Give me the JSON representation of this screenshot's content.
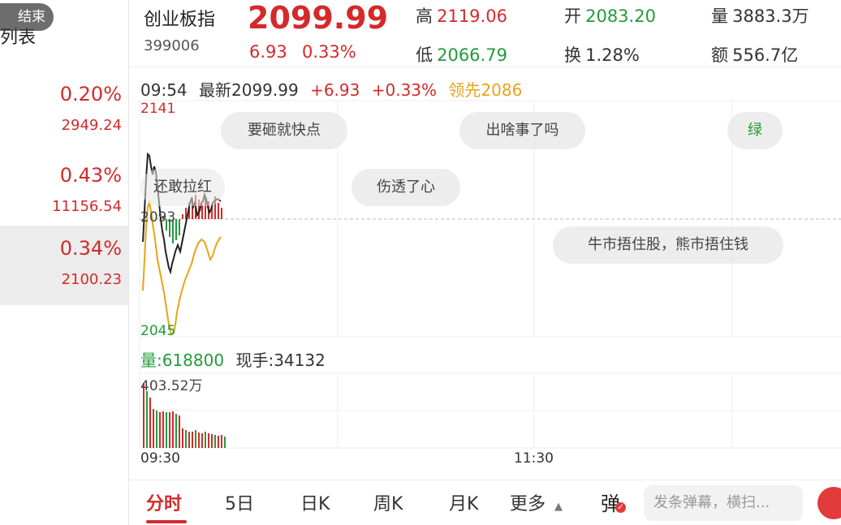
{
  "left_panel": {
    "end_pill": "结束",
    "list_label": "列表",
    "items": [
      {
        "pct": "0.20%",
        "value": "2949.24"
      },
      {
        "pct": "0.43%",
        "value": "11156.54"
      },
      {
        "pct": "0.34%",
        "value": "2100.23"
      }
    ]
  },
  "header": {
    "name": "创业板指",
    "code": "399006",
    "price": "2099.99",
    "change": "6.93",
    "change_pct": "0.33%",
    "stats": {
      "high_label": "高",
      "high": "2119.06",
      "low_label": "低",
      "low": "2066.79",
      "open_label": "开",
      "open": "2083.20",
      "turnover_label": "换",
      "turnover": "1.28%",
      "volume_label": "量",
      "volume": "3883.3万",
      "amount_label": "额",
      "amount": "556.7亿"
    }
  },
  "info_line": {
    "time": "09:54",
    "latest": "最新2099.99",
    "change": "+6.93",
    "change_pct": "+0.33%",
    "leader": "领先2086"
  },
  "chart": {
    "y_top": "2141",
    "y_mid": "2093",
    "y_bottom": "2045",
    "vol_max": "403.52万",
    "x_start": "09:30",
    "x_mid": "11:30"
  },
  "volume_line": {
    "volume": "量:618800",
    "hand": "现手:34132"
  },
  "danmu": [
    "要砸就快点",
    "出啥事了吗",
    "绿",
    "还敢拉红",
    "伤透了心",
    "牛市捂住股，熊市捂住钱"
  ],
  "tabs": [
    "分时",
    "5日",
    "日K",
    "周K",
    "月K",
    "更多"
  ],
  "danmu_toggle": "弹",
  "danmu_placeholder": "发条弹幕，横扫...",
  "colors": {
    "up": "#d42a2a",
    "down": "#239b3a",
    "leader": "#e8a317"
  }
}
